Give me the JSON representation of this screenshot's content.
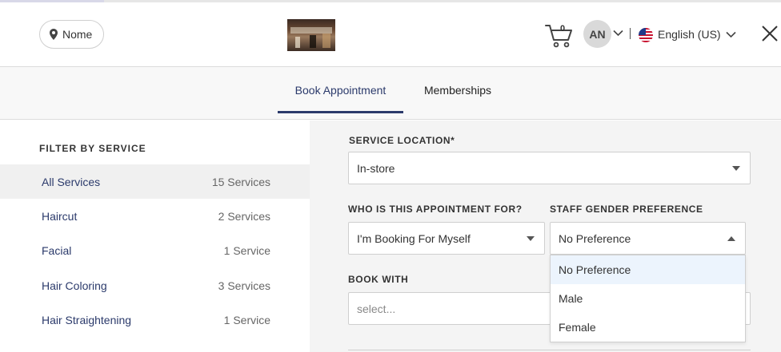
{
  "header": {
    "location_label": "Nome",
    "cart_count": "0",
    "avatar_initials": "AN",
    "language": "English (US)"
  },
  "tabs": [
    {
      "label": "Book Appointment",
      "active": true
    },
    {
      "label": "Memberships",
      "active": false
    }
  ],
  "sidebar": {
    "title": "FILTER BY SERVICE",
    "items": [
      {
        "label": "All Services",
        "count": "15 Services",
        "selected": true
      },
      {
        "label": "Haircut",
        "count": "2 Services",
        "selected": false
      },
      {
        "label": "Facial",
        "count": "1 Service",
        "selected": false
      },
      {
        "label": "Hair Coloring",
        "count": "3 Services",
        "selected": false
      },
      {
        "label": "Hair Straightening",
        "count": "1 Service",
        "selected": false
      }
    ]
  },
  "form": {
    "service_location_label": "SERVICE LOCATION*",
    "service_location_value": "In-store",
    "appointment_for_label": "WHO IS THIS APPOINTMENT FOR?",
    "appointment_for_value": "I'm Booking For Myself",
    "gender_pref_label": "STAFF GENDER PREFERENCE",
    "gender_pref_value": "No Preference",
    "gender_options": [
      "No Preference",
      "Male",
      "Female"
    ],
    "book_with_label": "BOOK WITH",
    "book_with_placeholder": "select..."
  },
  "colors": {
    "accent": "#2b3a6b",
    "highlight": "#ecf4fd",
    "selected_row": "#f0f0f0"
  }
}
